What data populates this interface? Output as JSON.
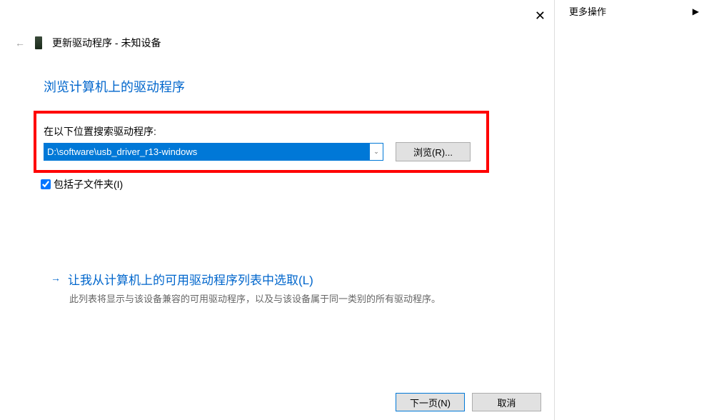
{
  "more_ops": {
    "label": "更多操作",
    "arrow": "▶"
  },
  "dialog": {
    "back": "←",
    "title": "更新驱动程序 - 未知设备",
    "close": "✕",
    "main_title": "浏览计算机上的驱动程序",
    "search_label": "在以下位置搜索驱动程序:",
    "path_value": "D:\\software\\usb_driver_r13-windows",
    "combo_drop": "⌄",
    "browse_btn": "浏览(R)...",
    "include_sub": "包括子文件夹(I)",
    "list_option_arrow": "→",
    "list_option_title": "让我从计算机上的可用驱动程序列表中选取(L)",
    "list_option_desc": "此列表将显示与该设备兼容的可用驱动程序，以及与该设备属于同一类别的所有驱动程序。",
    "next_btn": "下一页(N)",
    "cancel_btn": "取消"
  }
}
